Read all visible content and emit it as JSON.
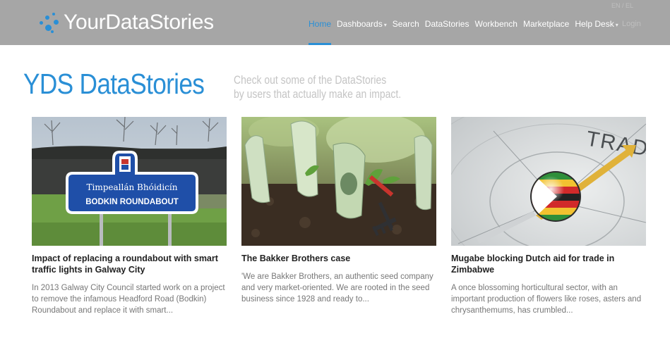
{
  "header": {
    "logo_text": "YourDataStories",
    "faint_top": "EN / EL",
    "faint_right": "Login",
    "nav": [
      {
        "label": "Home",
        "active": true,
        "has_caret": false
      },
      {
        "label": "Dashboards",
        "active": false,
        "has_caret": true
      },
      {
        "label": "Search",
        "active": false,
        "has_caret": false
      },
      {
        "label": "DataStories",
        "active": false,
        "has_caret": false
      },
      {
        "label": "Workbench",
        "active": false,
        "has_caret": false
      },
      {
        "label": "Marketplace",
        "active": false,
        "has_caret": false
      },
      {
        "label": "Help Desk",
        "active": false,
        "has_caret": true
      }
    ]
  },
  "main": {
    "title": "YDS DataStories",
    "tagline_line1": "Check out some of the DataStories",
    "tagline_line2": "by users that actually make an impact."
  },
  "cards": [
    {
      "title": "Impact of replacing a roundabout with smart traffic lights in Galway City",
      "excerpt": "In 2013 Galway City Council started work on a project to remove the infamous Headford Road (Bodkin) Roundabout and replace it with smart...",
      "sign_line1": "Timpeallán Bhóidicín",
      "sign_line2": "BODKIN ROUNDABOUT"
    },
    {
      "title": "The Bakker Brothers case",
      "excerpt": "'We are Bakker Brothers, an authentic seed company and very market-oriented. We are rooted in the seed business since 1928 and ready to..."
    },
    {
      "title": "Mugabe blocking Dutch aid for trade in Zimbabwe",
      "excerpt": "A once blossoming horticultural sector, with an important production of flowers like roses, asters and chrysanthemums, has crumbled...",
      "compass_text": "TRADE"
    }
  ],
  "colors": {
    "accent": "#2a8fd6",
    "navbar_bg": "#a6a6a6",
    "tagline": "#c4c4c4",
    "card_title": "#222222",
    "card_excerpt": "#777777"
  },
  "icons": {
    "caret": "chevron-down-icon",
    "logo": "dots-logo-icon"
  }
}
